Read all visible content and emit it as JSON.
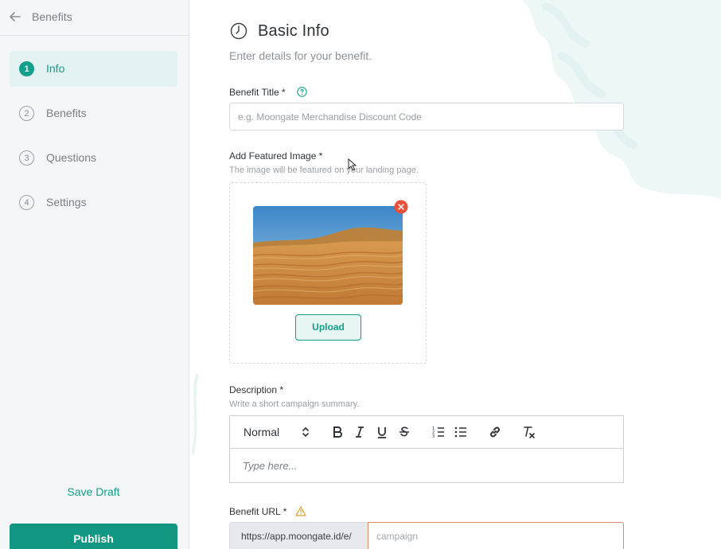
{
  "sidebar": {
    "title": "Benefits",
    "steps": [
      {
        "num": "1",
        "label": "Info"
      },
      {
        "num": "2",
        "label": "Benefits"
      },
      {
        "num": "3",
        "label": "Questions"
      },
      {
        "num": "4",
        "label": "Settings"
      }
    ],
    "active_step": "Info",
    "save_draft": "Save Draft",
    "publish": "Publish"
  },
  "main": {
    "title": "Basic Info",
    "subtitle": "Enter details for your benefit.",
    "benefit_title": {
      "label": "Benefit Title *",
      "placeholder": "e.g. Moongate Merchandise Discount Code",
      "value": ""
    },
    "featured_image": {
      "label": "Add Featured Image *",
      "hint": "The image will be featured on your landing page.",
      "upload_label": "Upload"
    },
    "description": {
      "label": "Description *",
      "hint": "Write a short campaign summary.",
      "format_select": "Normal",
      "placeholder": "Type here..."
    },
    "benefit_url": {
      "label": "Benefit URL *",
      "prefix": "https://app.moongate.id/e/",
      "placeholder": "campaign",
      "value": ""
    }
  },
  "colors": {
    "accent": "#13a08a",
    "publish_bg": "#129782",
    "active_step_bg": "#e2f3f1",
    "warning": "#e0a030",
    "error": "#e8503a"
  }
}
